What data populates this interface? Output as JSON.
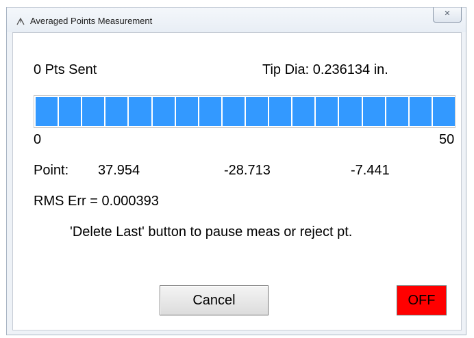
{
  "window": {
    "title": "Averaged Points Measurement",
    "icon": "probe-icon",
    "close_label": "✕"
  },
  "status": {
    "pts_sent": "0 Pts Sent",
    "tip_dia": "Tip Dia: 0.236134 in."
  },
  "progress": {
    "min_label": "0",
    "max_label": "50",
    "segments": 18,
    "fill_fraction": 1.0,
    "color": "#3399ff"
  },
  "point": {
    "label": "Point:",
    "x": "37.954",
    "y": "-28.713",
    "z": "-7.441"
  },
  "rms": "RMS Err = 0.000393",
  "hint": "'Delete Last' button to pause meas or reject pt.",
  "buttons": {
    "cancel": "Cancel",
    "off": "OFF",
    "off_color": "#ff0000"
  }
}
